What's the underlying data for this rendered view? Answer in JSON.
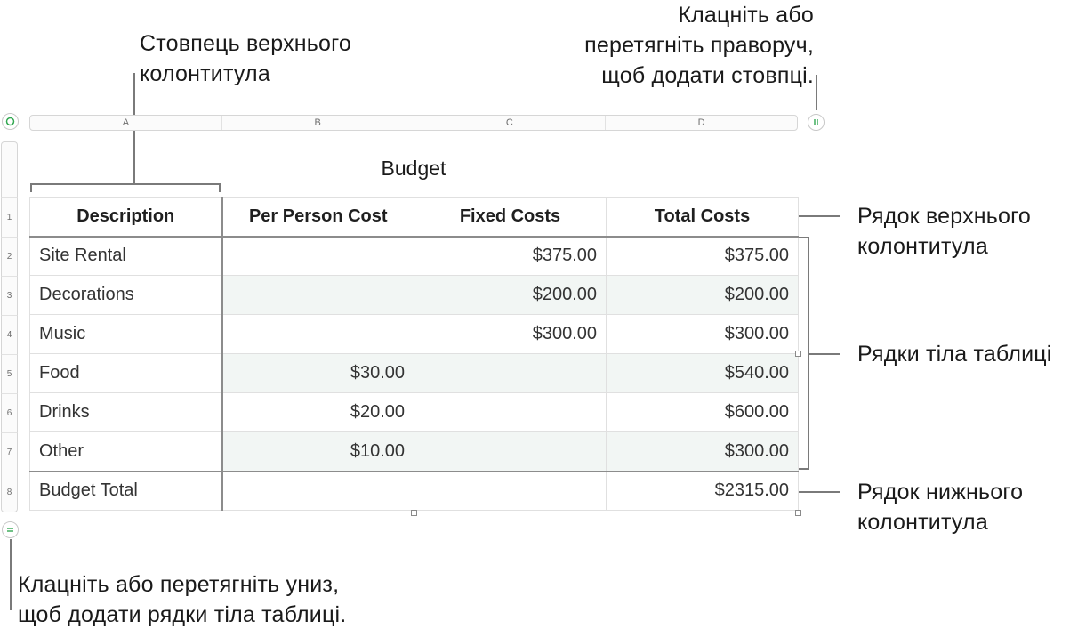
{
  "callouts": {
    "header_column": [
      "Стовпець верхнього",
      "колонтитула"
    ],
    "add_columns": [
      "Клацніть або",
      "перетягніть праворуч,",
      "щоб додати стовпці."
    ],
    "header_row": [
      "Рядок верхнього",
      "колонтитула"
    ],
    "body_rows": "Рядки тіла таблиці",
    "footer_row": [
      "Рядок нижнього",
      "колонтитула"
    ],
    "add_rows": [
      "Клацніть або перетягніть униз,",
      "щоб додати рядки тіла таблиці."
    ]
  },
  "column_letters": [
    "A",
    "B",
    "C",
    "D"
  ],
  "row_numbers": [
    "1",
    "2",
    "3",
    "4",
    "5",
    "6",
    "7",
    "8"
  ],
  "table": {
    "title": "Budget",
    "headers": [
      "Description",
      "Per Person Cost",
      "Fixed Costs",
      "Total Costs"
    ],
    "rows": [
      [
        "Site Rental",
        "",
        "$375.00",
        "$375.00"
      ],
      [
        "Decorations",
        "",
        "$200.00",
        "$200.00"
      ],
      [
        "Music",
        "",
        "$300.00",
        "$300.00"
      ],
      [
        "Food",
        "$30.00",
        "",
        "$540.00"
      ],
      [
        "Drinks",
        "$20.00",
        "",
        "$600.00"
      ],
      [
        "Other",
        "$10.00",
        "",
        "$300.00"
      ]
    ],
    "footer": [
      "Budget Total",
      "",
      "",
      "$2315.00"
    ]
  },
  "icons": {
    "select_table": "circle-icon",
    "add_columns": "column-resize-icon",
    "add_rows": "row-resize-icon"
  },
  "colors": {
    "accent": "#34a853",
    "alt_row": "#f2f6f4"
  }
}
